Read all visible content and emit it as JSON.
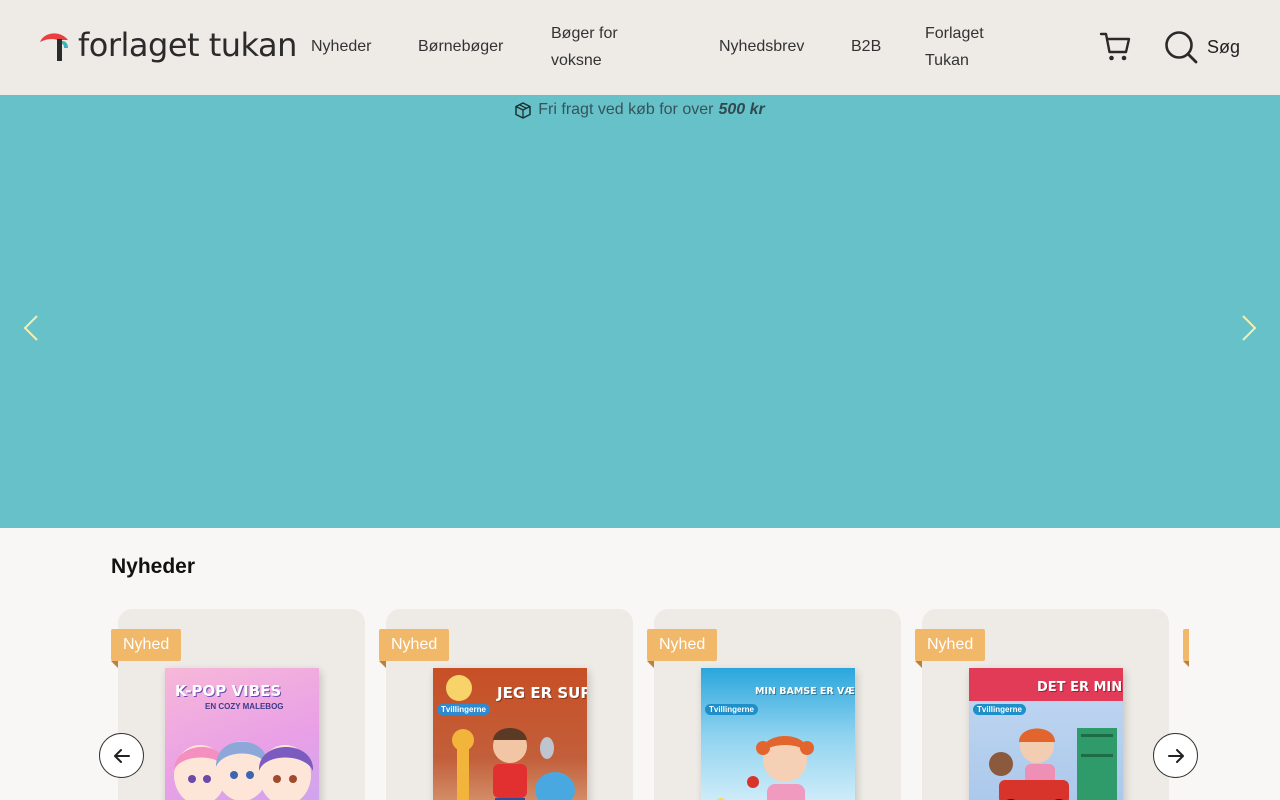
{
  "brand": {
    "name": "forlaget tukan",
    "colors": {
      "header_bg": "#eeebe6",
      "hero_bg": "#66c1c8",
      "badge": "#f2b86a",
      "logo_red": "#e9403f",
      "logo_teal": "#3ab3b8"
    }
  },
  "nav": {
    "items": [
      {
        "label": "Nyheder"
      },
      {
        "label": "Børnebøger"
      },
      {
        "label": "Bøger for voksne"
      },
      {
        "label": "Nyhedsbrev"
      },
      {
        "label": "B2B"
      },
      {
        "label": "Forlaget Tukan"
      }
    ],
    "cart_icon": "cart-icon",
    "search_icon": "search-icon",
    "search_label": "Søg"
  },
  "hero": {
    "shipping_icon": "box-icon",
    "shipping_text": "Fri fragt ved køb for over",
    "shipping_amount": "500 kr",
    "prev_icon": "chevron-left-icon",
    "next_icon": "chevron-right-icon"
  },
  "news": {
    "title": "Nyheder",
    "products": [
      {
        "badge": "Nyhed",
        "cover_title": "K-POP VIBES",
        "cover_subtitle": "EN COZY MALEBOG",
        "cover_color": "#f3a9cf"
      },
      {
        "badge": "Nyhed",
        "cover_title": "JEG ER SUR!",
        "cover_subtitle": "Tvillingerne",
        "cover_color": "#c6512a"
      },
      {
        "badge": "Nyhed",
        "cover_title": "MIN BAMSE ER VÆK!",
        "cover_subtitle": "Tvillingerne",
        "cover_color": "#2aa6dc"
      },
      {
        "badge": "Nyhed",
        "cover_title": "DET ER MIN!",
        "cover_subtitle": "Tvillingerne",
        "cover_color": "#e23b58"
      }
    ],
    "prev_icon": "arrow-left-icon",
    "next_icon": "arrow-right-icon"
  }
}
